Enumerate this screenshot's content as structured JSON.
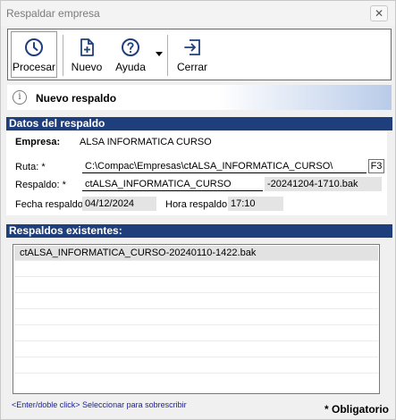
{
  "window": {
    "title": "Respaldar empresa",
    "close_glyph": "✕"
  },
  "toolbar": {
    "buttons": [
      {
        "label": "Procesar",
        "icon": "clock-icon"
      },
      {
        "label": "Nuevo",
        "icon": "new-document-icon"
      },
      {
        "label": "Ayuda",
        "icon": "help-icon"
      },
      {
        "label": "Cerrar",
        "icon": "exit-icon"
      }
    ]
  },
  "info_bar": {
    "icon_glyph": "i",
    "text": "Nuevo respaldo"
  },
  "datos": {
    "header": "Datos del respaldo",
    "empresa_label": "Empresa:",
    "empresa_value": "ALSA INFORMATICA CURSO",
    "ruta_label": "Ruta: *",
    "ruta_value": "C:\\Compac\\Empresas\\ctALSA_INFORMATICA_CURSO\\",
    "ruta_button": "F3",
    "respaldo_label": "Respaldo: *",
    "respaldo_value": "ctALSA_INFORMATICA_CURSO",
    "respaldo_suffix": "-20241204-1710.bak",
    "fecha_label": "Fecha respaldo",
    "fecha_value": "04/12/2024",
    "hora_label": "Hora respaldo",
    "hora_value": "17:10"
  },
  "existentes": {
    "header": "Respaldos existentes:",
    "items": [
      "ctALSA_INFORMATICA_CURSO-20240110-1422.bak"
    ]
  },
  "footer": {
    "hint": "<Enter/doble click> Seleccionar para sobrescribir",
    "required_note": "* Obligatorio"
  },
  "colors": {
    "section_header": "#1f3f7c",
    "hint_text": "#1a1a9a"
  }
}
